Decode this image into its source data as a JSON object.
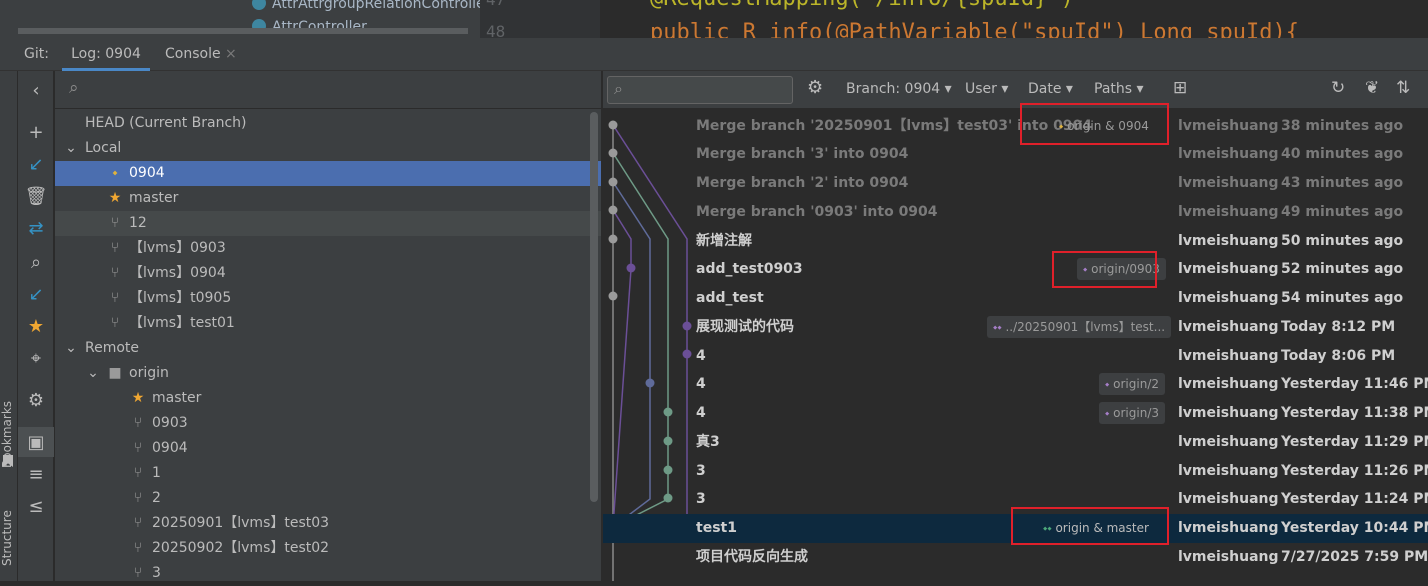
{
  "editor": {
    "project_items": [
      "AttrAttrgroupRelationControlle",
      "AttrController"
    ],
    "line_numbers": [
      "47",
      "48"
    ],
    "code_line_1": "@RequestMapping(\"/info/{spuId}\")",
    "code_line_2": "public R info(@PathVariable(\"spuId\") Long spuId){"
  },
  "tabs": {
    "git_label": "Git:",
    "log_tab": "Log: 0904",
    "console_tab": "Console",
    "console_close": "×"
  },
  "side_labels": {
    "bookmarks": "Bookmarks",
    "structure": "Structure"
  },
  "branches": {
    "head": "HEAD (Current Branch)",
    "local_label": "Local",
    "local": [
      {
        "name": "0904",
        "icon": "tag-icon",
        "selected": true
      },
      {
        "name": "master",
        "icon": "star-icon"
      },
      {
        "name": "12",
        "icon": "branch-icon",
        "hover": true
      },
      {
        "name": "【lvms】0903",
        "icon": "branch-icon"
      },
      {
        "name": "【lvms】0904",
        "icon": "branch-icon"
      },
      {
        "name": "【lvms】t0905",
        "icon": "branch-icon"
      },
      {
        "name": "【lvms】test01",
        "icon": "branch-icon"
      }
    ],
    "remote_label": "Remote",
    "origin_label": "origin",
    "remote": [
      {
        "name": "master",
        "icon": "star-icon"
      },
      {
        "name": "0903",
        "icon": "branch-icon"
      },
      {
        "name": "0904",
        "icon": "branch-icon"
      },
      {
        "name": "1",
        "icon": "branch-icon"
      },
      {
        "name": "2",
        "icon": "branch-icon"
      },
      {
        "name": "20250901【lvms】test03",
        "icon": "branch-icon"
      },
      {
        "name": "20250902【lvms】test02",
        "icon": "branch-icon"
      },
      {
        "name": "3",
        "icon": "branch-icon"
      }
    ]
  },
  "log_toolbar": {
    "branch_filter": "Branch: 0904",
    "user_filter": "User",
    "date_filter": "Date",
    "paths_filter": "Paths"
  },
  "commits": [
    {
      "message": "Merge branch '20250901【lvms】test03' into 0904",
      "tag": "origin & 0904",
      "author": "lvmeishuang",
      "date": "38 minutes ago",
      "dim": true
    },
    {
      "message": "Merge branch '3' into 0904",
      "tag": "",
      "author": "lvmeishuang",
      "date": "40 minutes ago",
      "dim": true
    },
    {
      "message": "Merge branch '2' into 0904",
      "tag": "",
      "author": "lvmeishuang",
      "date": "43 minutes ago",
      "dim": true
    },
    {
      "message": "Merge branch '0903' into 0904",
      "tag": "",
      "author": "lvmeishuang",
      "date": "49 minutes ago",
      "dim": true
    },
    {
      "message": "新增注解",
      "tag": "",
      "author": "lvmeishuang",
      "date": "50 minutes ago"
    },
    {
      "message": "add_test0903",
      "tag": "origin/0903",
      "author": "lvmeishuang",
      "date": "52 minutes ago"
    },
    {
      "message": "add_test",
      "tag": "",
      "author": "lvmeishuang",
      "date": "54 minutes ago"
    },
    {
      "message": "展现测试的代码",
      "tag": "../20250901【lvms】test...",
      "author": "lvmeishuang",
      "date": "Today 8:12 PM"
    },
    {
      "message": "4",
      "tag": "",
      "author": "lvmeishuang",
      "date": "Today 8:06 PM"
    },
    {
      "message": "4",
      "tag": "origin/2",
      "author": "lvmeishuang",
      "date": "Yesterday 11:46 PM"
    },
    {
      "message": "4",
      "tag": "origin/3",
      "author": "lvmeishuang",
      "date": "Yesterday 11:38 PM"
    },
    {
      "message": "真3",
      "tag": "",
      "author": "lvmeishuang",
      "date": "Yesterday 11:29 PM"
    },
    {
      "message": "3",
      "tag": "",
      "author": "lvmeishuang",
      "date": "Yesterday 11:26 PM"
    },
    {
      "message": "3",
      "tag": "",
      "author": "lvmeishuang",
      "date": "Yesterday 11:24 PM"
    },
    {
      "message": "test1",
      "tag": "origin & master",
      "author": "lvmeishuang",
      "date": "Yesterday 10:44 PM",
      "selected": true
    },
    {
      "message": "项目代码反向生成",
      "tag": "",
      "author": "lvmeishuang",
      "date": "7/27/2025 7:59 PM"
    }
  ],
  "colors": {
    "accent": "#4a88c7",
    "selection": "#4b6eaf",
    "highlight": "#e0202a"
  }
}
